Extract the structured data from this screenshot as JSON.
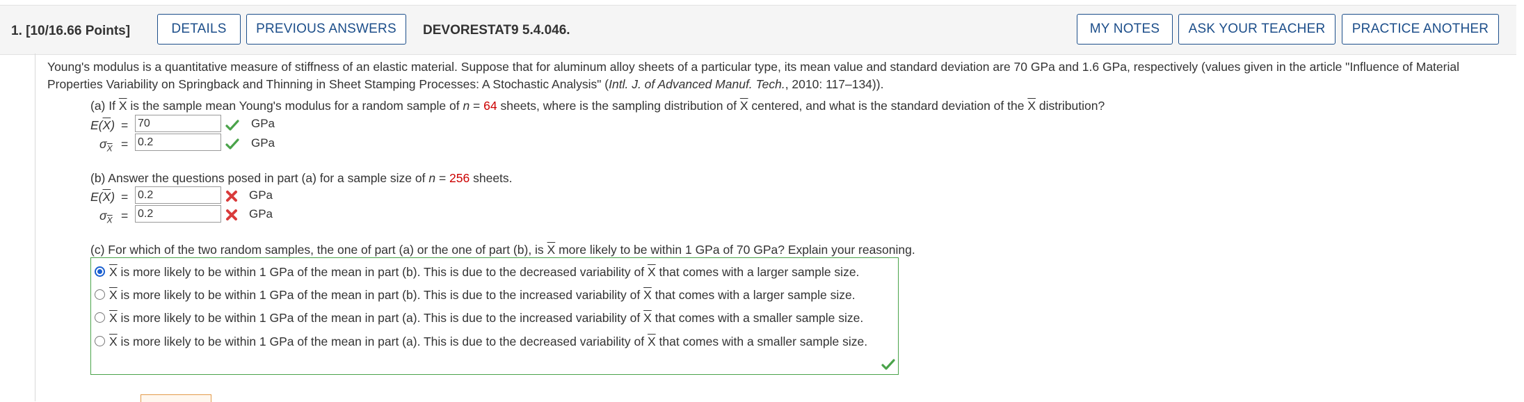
{
  "header": {
    "question_number": "1. [10/16.66 Points]",
    "details_label": "DETAILS",
    "previous_answers_label": "PREVIOUS ANSWERS",
    "question_code": "DEVORESTAT9 5.4.046.",
    "my_notes_label": "MY NOTES",
    "ask_teacher_label": "ASK YOUR TEACHER",
    "practice_another_label": "PRACTICE ANOTHER"
  },
  "intro": {
    "line1": "Young's modulus is a quantitative measure of stiffness of an elastic material. Suppose that for aluminum alloy sheets of a particular type, its mean value and standard deviation are 70 GPa and 1.6 GPa, respectively (values given in the article \"Influence of Material",
    "line2_a": "Properties Variability on Springback and Thinning in Sheet Stamping Processes: A Stochastic Analysis\" (",
    "line2_italic": "Intl. J. of Advanced Manuf. Tech.",
    "line2_b": ", 2010: 117–134))."
  },
  "part_a": {
    "q_a": "(a) If ",
    "x": "X",
    "q_b": " is the sample mean Young's modulus for a random sample of ",
    "n": "n",
    "eq": " = ",
    "n_value": "64",
    "q_c": " sheets, where is the sampling distribution of ",
    "q_d": " centered, and what is the standard deviation of the ",
    "q_e": " distribution?",
    "ex_label_a": "E(",
    "ex_label_b": ")",
    "eq_sign": "=",
    "sigma": "σ",
    "ex_value": "70",
    "sd_value": "0.2",
    "unit": "GPa"
  },
  "part_b": {
    "q_a": "(b) Answer the questions posed in part (a) for a sample size of ",
    "n": "n",
    "eq": " = ",
    "n_value": "256",
    "q_b": " sheets.",
    "ex_value": "0.2",
    "sd_value": "0.2",
    "unit": "GPa"
  },
  "part_c": {
    "q_a": "(c) For which of the two random samples, the one of part (a) or the one of part (b), is ",
    "x": "X",
    "q_b": " more likely to be within 1 GPa of 70 GPa? Explain your reasoning.",
    "options": [
      {
        "pre": " is more likely to be within 1 GPa of the mean in part (b). This is due to the decreased variability of ",
        "post": " that comes with a larger sample size."
      },
      {
        "pre": " is more likely to be within 1 GPa of the mean in part (b). This is due to the increased variability of ",
        "post": " that comes with a larger sample size."
      },
      {
        "pre": " is more likely to be within 1 GPa of the mean in part (a). This is due to the increased variability of ",
        "post": " that comes with a smaller sample size."
      },
      {
        "pre": " is more likely to be within 1 GPa of the mean in part (a). This is due to the decreased variability of ",
        "post": " that comes with a smaller sample size."
      }
    ],
    "selected_index": 0
  },
  "colors": {
    "brand_blue": "#1c4e8a",
    "correct_green": "#4aa34a",
    "incorrect_red": "#d93b3b",
    "highlight_red": "#cc0000"
  },
  "icons": {
    "correct": "check-icon",
    "incorrect": "x-icon"
  }
}
